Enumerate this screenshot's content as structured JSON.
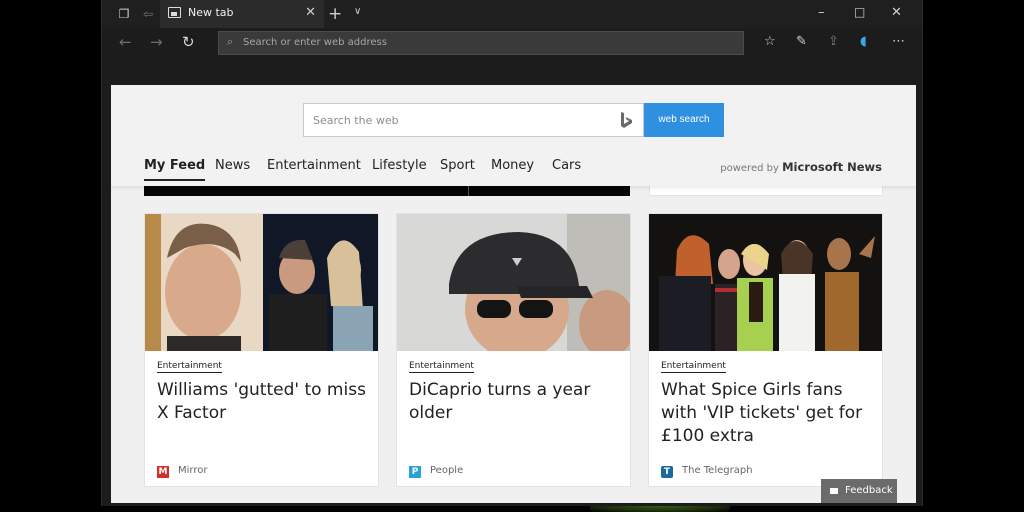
{
  "browser": {
    "tab": {
      "title": "New tab"
    },
    "address_bar": {
      "placeholder": "Search or enter web address"
    },
    "icons": {
      "set_aside": "tabs-aside-icon",
      "restore": "restore-tabs-icon",
      "new_tab": "plus-icon",
      "tab_list": "chevron-down-icon",
      "minimize": "minimize-icon",
      "maximize": "maximize-icon",
      "close": "close-icon",
      "back": "back-arrow-icon",
      "forward": "forward-arrow-icon",
      "refresh": "refresh-icon",
      "favorites": "favorites-icon",
      "notes": "pen-icon",
      "share": "share-icon",
      "extension": "shield-extension-icon",
      "more": "more-icon"
    }
  },
  "newtab": {
    "search": {
      "placeholder": "Search the web",
      "button": "web search"
    },
    "feed_nav": [
      "My Feed",
      "News",
      "Entertainment",
      "Lifestyle",
      "Sport",
      "Money",
      "Cars"
    ],
    "active_tab": "My Feed",
    "powered_by": {
      "prefix": "powered by",
      "brand": "Microsoft News"
    },
    "cards": [
      {
        "category": "Entertainment",
        "title": "Williams 'gutted' to miss X Factor",
        "source": "Mirror",
        "source_logo": "M",
        "logo_color": "#d32f2f"
      },
      {
        "category": "Entertainment",
        "title": "DiCaprio turns a year older",
        "source": "People",
        "source_logo": "P",
        "logo_color": "#2aa0d8"
      },
      {
        "category": "Entertainment",
        "title": "What Spice Girls fans with 'VIP tickets' get for £100 extra",
        "source": "The Telegraph",
        "source_logo": "T",
        "logo_color": "#1a6aa0"
      }
    ],
    "feedback": "Feedback"
  },
  "colors": {
    "accent": "#2f8fe0",
    "chrome_dark": "#1f1f1f",
    "page_bg": "#f0f0f0"
  }
}
